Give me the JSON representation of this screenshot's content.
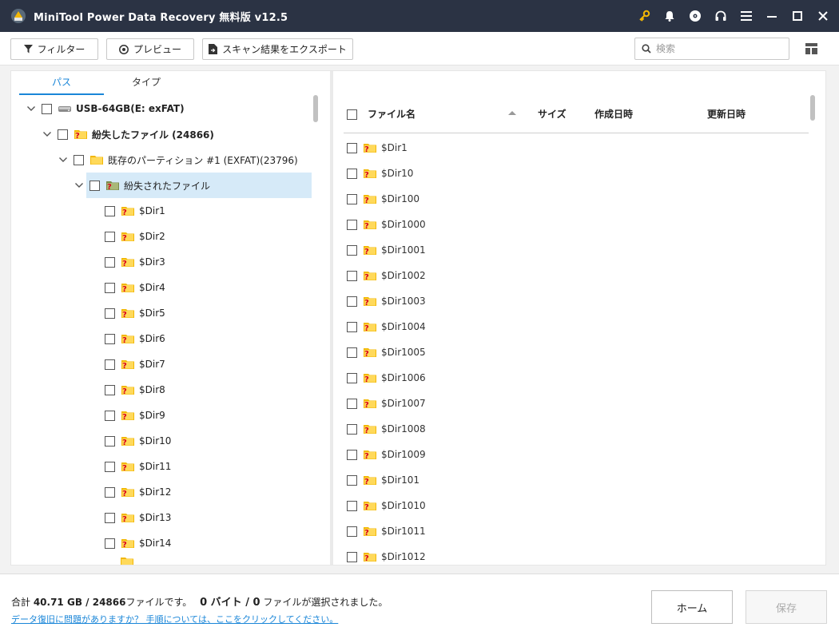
{
  "window": {
    "title": "MiniTool Power Data Recovery 無料版 v12.5",
    "icons": [
      "key-icon",
      "bell-icon",
      "disc-icon",
      "headset-icon",
      "menu-icon",
      "minimize-icon",
      "maximize-icon",
      "close-icon"
    ],
    "accent_color": "#f2b705",
    "titlebar_color": "#2b3344"
  },
  "toolbar": {
    "filter_label": "フィルター",
    "preview_label": "プレビュー",
    "export_label": "スキャン結果をエクスポート",
    "search_placeholder": "検索"
  },
  "tabs": {
    "path_label": "パス",
    "type_label": "タイプ",
    "active": "パス"
  },
  "tree": {
    "drive": "USB-64GB(E: exFAT)",
    "lost_files": "紛失したファイル (24866)",
    "partition": "既存のパーティション #1 (EXFAT)(23796)",
    "lost_folder": "紛失されたファイル",
    "children": [
      "$Dir1",
      "$Dir2",
      "$Dir3",
      "$Dir4",
      "$Dir5",
      "$Dir6",
      "$Dir7",
      "$Dir8",
      "$Dir9",
      "$Dir10",
      "$Dir11",
      "$Dir12",
      "$Dir13",
      "$Dir14"
    ]
  },
  "file_list": {
    "columns": {
      "name": "ファイル名",
      "size": "サイズ",
      "created": "作成日時",
      "modified": "更新日時"
    },
    "rows": [
      "$Dir1",
      "$Dir10",
      "$Dir100",
      "$Dir1000",
      "$Dir1001",
      "$Dir1002",
      "$Dir1003",
      "$Dir1004",
      "$Dir1005",
      "$Dir1006",
      "$Dir1007",
      "$Dir1008",
      "$Dir1009",
      "$Dir101",
      "$Dir1010",
      "$Dir1011",
      "$Dir1012"
    ]
  },
  "footer": {
    "summary_prefix": "合計 ",
    "total_size": "40.71 GB",
    "slash1": " / ",
    "total_files": "24866",
    "files_text": "ファイルです。",
    "selected_size": "0 バイト",
    "slash2": " / ",
    "selected_count": "0",
    "selected_text": " ファイルが選択されました。",
    "help_link": "データ復旧に問題がありますか？ 手順については、ここをクリックしてください。",
    "home_label": "ホーム",
    "save_label": "保存"
  }
}
